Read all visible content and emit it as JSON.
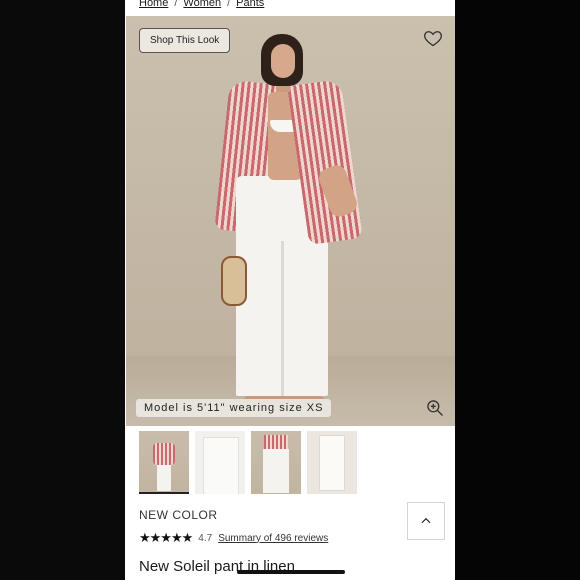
{
  "breadcrumb": [
    "Home",
    "Women",
    "Pants"
  ],
  "breadcrumb_sep": "/",
  "hero": {
    "shop_look_label": "Shop This Look",
    "model_note": "Model is 5'11\" wearing size XS"
  },
  "icons": {
    "favorite": "heart-icon",
    "zoom": "zoom-in-icon",
    "back_to_top": "chevron-up-icon"
  },
  "thumbnails": [
    {
      "alt": "model front view"
    },
    {
      "alt": "pants detail"
    },
    {
      "alt": "model lower body"
    },
    {
      "alt": "pants flat lay"
    }
  ],
  "product": {
    "badge": "NEW COLOR",
    "stars": "★★★★★",
    "rating": "4.7",
    "reviews_link": "Summary of 496 reviews",
    "title": "New Soleil pant in linen"
  },
  "colors": {
    "stripe": "#c86a6d",
    "background": "#000000",
    "text": "#222222"
  }
}
